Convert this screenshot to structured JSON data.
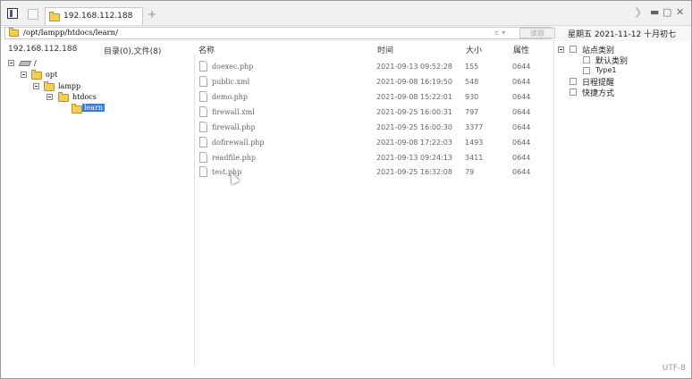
{
  "tab": {
    "title": "192.168.112.188"
  },
  "address": {
    "path": "/opt/lampp/htdocs/learn/",
    "read_label": "读取",
    "arrows": "± ▾"
  },
  "datebar": {
    "date": "星期五  2021-11-12  十月初七"
  },
  "left_pane": {
    "host": "192.168.112.188",
    "count": "目录(0),文件(8)",
    "tree": [
      {
        "label": "/"
      },
      {
        "label": "opt"
      },
      {
        "label": "lampp"
      },
      {
        "label": "htdocs"
      },
      {
        "label": "learn",
        "selected": true
      }
    ]
  },
  "file_list": {
    "headers": {
      "name": "名称",
      "time": "时间",
      "size": "大小",
      "attr": "属性"
    },
    "rows": [
      {
        "name": "doexec.php",
        "time": "2021-09-13 09:52:28",
        "size": "155",
        "attr": "0644"
      },
      {
        "name": "public.xml",
        "time": "2021-09-08 16:19:50",
        "size": "548",
        "attr": "0644"
      },
      {
        "name": "demo.php",
        "time": "2021-09-08 15:22:01",
        "size": "930",
        "attr": "0644"
      },
      {
        "name": "firewall.xml",
        "time": "2021-09-25 16:00:31",
        "size": "797",
        "attr": "0644"
      },
      {
        "name": "firewall.php",
        "time": "2021-09-25 16:00:30",
        "size": "3377",
        "attr": "0644"
      },
      {
        "name": "dofirewall.php",
        "time": "2021-09-08 17:22:03",
        "size": "1493",
        "attr": "0644"
      },
      {
        "name": "readfile.php",
        "time": "2021-09-13 09:24:13",
        "size": "3411",
        "attr": "0644"
      },
      {
        "name": "test.php",
        "time": "2021-09-25 16:32:08",
        "size": "79",
        "attr": "0644"
      }
    ]
  },
  "right_pane": {
    "site_category": "站点类别",
    "default_category": "默认类别",
    "type1": "Type1",
    "schedule": "日程提醒",
    "shortcuts": "快捷方式"
  },
  "status": {
    "encoding": "UTF-8"
  },
  "colors": {
    "selection": "#3b7bd6",
    "folder": "#f2cf5a"
  }
}
